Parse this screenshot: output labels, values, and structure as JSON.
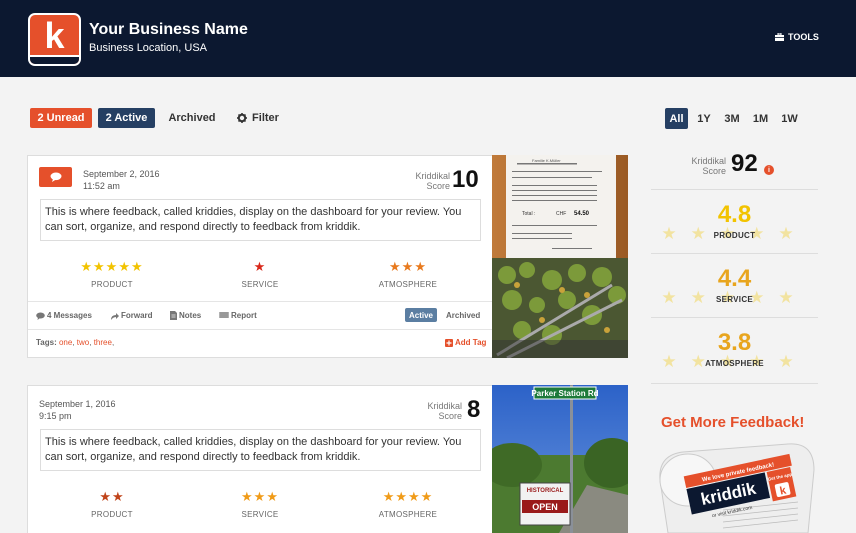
{
  "header": {
    "logo_letter": "k",
    "business_name": "Your Business Name",
    "business_location": "Business Location, USA",
    "tools_label": "TOOLS"
  },
  "filters": {
    "unread": "2 Unread",
    "active": "2 Active",
    "archived": "Archived",
    "filter": "Filter"
  },
  "time_range": {
    "options": [
      "All",
      "1Y",
      "3M",
      "1M",
      "1W"
    ],
    "selected": "All"
  },
  "cards": [
    {
      "date": "September 2, 2016",
      "time": "11:52 am",
      "score_label_1": "Kriddikal",
      "score_label_2": "Score",
      "score": "10",
      "text": "This is where feedback, called kriddies, display on the dashboard for your review. You can sort, organize, and respond directly to feedback from kriddik.",
      "ratings": [
        {
          "label": "PRODUCT",
          "stars": 5
        },
        {
          "label": "SERVICE",
          "stars": 1
        },
        {
          "label": "ATMOSPHERE",
          "stars": 3
        }
      ],
      "actions": {
        "messages": "4 Messages",
        "forward": "Forward",
        "notes": "Notes",
        "report": "Report",
        "active": "Active",
        "archived": "Archived"
      },
      "tags_label": "Tags:",
      "tags": [
        "one",
        "two",
        "three"
      ],
      "add_tag": "Add Tag",
      "receipt": {
        "header": "Familie K.Müller",
        "total_label": "Total :",
        "total_currency": "CHF",
        "total_value": "54.50"
      }
    },
    {
      "date": "September 1, 2016",
      "time": "9:15 pm",
      "score_label_1": "Kriddikal",
      "score_label_2": "Score",
      "score": "8",
      "text": "This is where feedback, called kriddies, display on the dashboard for your review. You can sort, organize, and respond directly to feedback from kriddik.",
      "ratings": [
        {
          "label": "PRODUCT",
          "stars": 2
        },
        {
          "label": "SERVICE",
          "stars": 3
        },
        {
          "label": "ATMOSPHERE",
          "stars": 4
        }
      ],
      "sign": {
        "street": "Parker Station Rd",
        "historical": "HISTORICAL",
        "open": "OPEN"
      }
    }
  ],
  "sidebar": {
    "score_label_1": "Kriddikal",
    "score_label_2": "Score",
    "score": "92",
    "info_icon_text": "i",
    "product": {
      "value": "4.8",
      "label": "PRODUCT",
      "color": "#f2c300"
    },
    "service": {
      "value": "4.4",
      "label": "SERVICE",
      "color": "#e8a51e"
    },
    "atmosphere": {
      "value": "3.8",
      "label": "ATMOSPHERE",
      "color": "#e8a51e"
    },
    "get_more": "Get More Feedback!",
    "promo": {
      "banner": "We love private feedback!",
      "brand": "kriddik",
      "visit": "or visit kriddik.com",
      "get_app": "Get the app",
      "logo_letter": "k"
    }
  },
  "colors": {
    "header_bg": "#0c1830",
    "accent": "#e5502b",
    "navy": "#253f63"
  }
}
